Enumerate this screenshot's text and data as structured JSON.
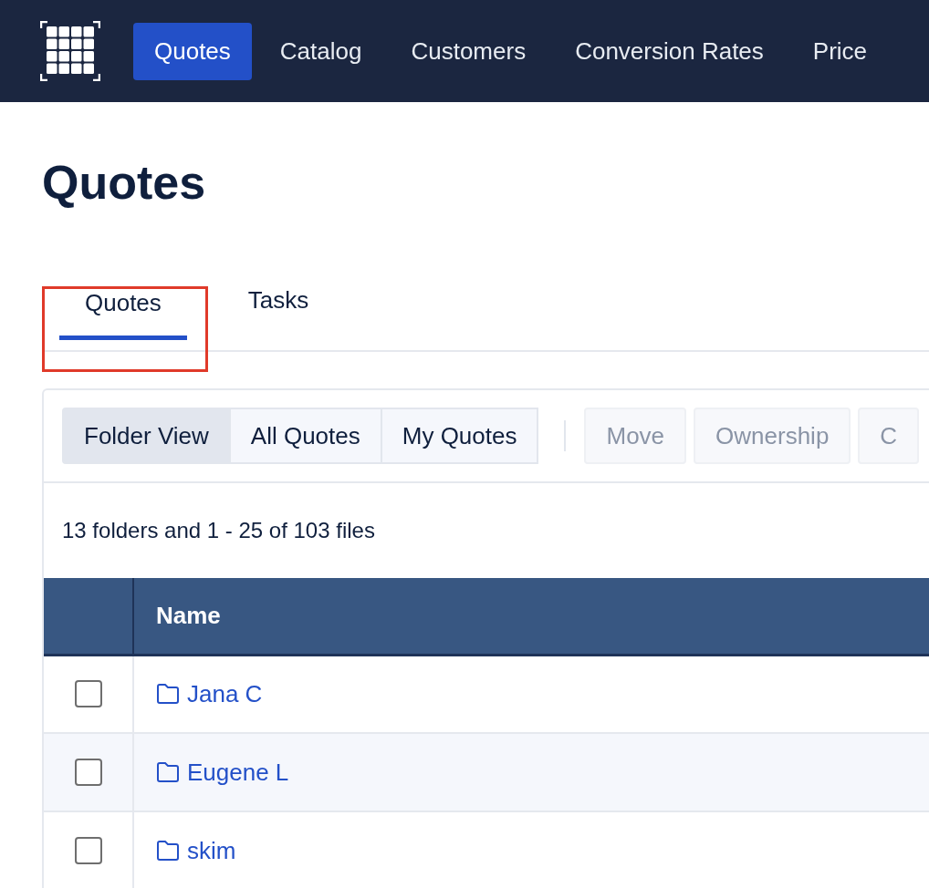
{
  "nav": {
    "items": [
      {
        "label": "Quotes",
        "selected": true
      },
      {
        "label": "Catalog",
        "selected": false
      },
      {
        "label": "Customers",
        "selected": false
      },
      {
        "label": "Conversion Rates",
        "selected": false
      },
      {
        "label": "Price",
        "selected": false
      }
    ]
  },
  "page_title": "Quotes",
  "tabs": [
    {
      "label": "Quotes",
      "selected": true,
      "highlighted": true
    },
    {
      "label": "Tasks",
      "selected": false,
      "highlighted": false
    }
  ],
  "view_buttons": [
    {
      "label": "Folder View",
      "selected": true
    },
    {
      "label": "All Quotes",
      "selected": false
    },
    {
      "label": "My Quotes",
      "selected": false
    }
  ],
  "action_buttons": [
    {
      "label": "Move",
      "disabled": true
    },
    {
      "label": "Ownership",
      "disabled": true
    },
    {
      "label": "C",
      "disabled": true
    }
  ],
  "summary": "13 folders and 1 - 25 of 103 files",
  "table": {
    "columns": [
      "Name"
    ],
    "rows": [
      {
        "name": "Jana C",
        "checked": false
      },
      {
        "name": "Eugene L",
        "checked": false
      },
      {
        "name": "skim",
        "checked": false
      }
    ]
  }
}
